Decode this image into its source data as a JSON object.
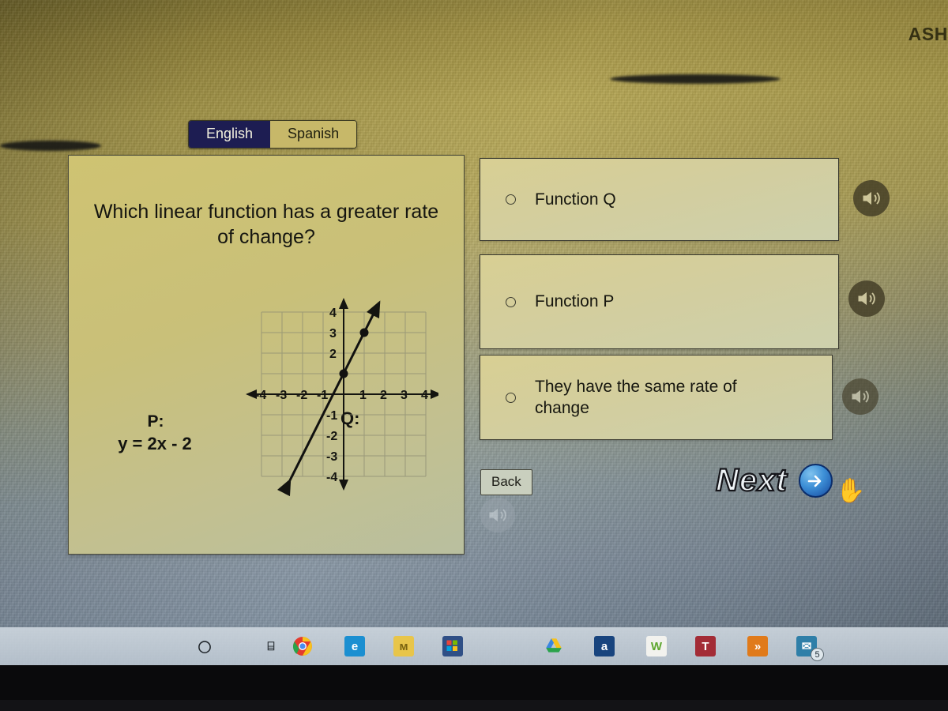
{
  "header": {
    "title": "ASH"
  },
  "language_tabs": [
    {
      "label": "English",
      "selected": true
    },
    {
      "label": "Spanish",
      "selected": false
    }
  ],
  "question": {
    "text": "Which linear function has a greater rate of change?",
    "function_p_label": "P:",
    "function_p_equation": "y = 2x - 2",
    "function_q_label": "Q:"
  },
  "chart_data": {
    "type": "line",
    "title": "Q:",
    "xlabel": "",
    "ylabel": "",
    "xlim": [
      -5,
      5
    ],
    "ylim": [
      -5,
      5
    ],
    "grid": true,
    "x_ticks": [
      -4,
      -3,
      -2,
      -1,
      1,
      2,
      3,
      4
    ],
    "y_ticks": [
      4,
      3,
      2,
      -1,
      -2,
      -3,
      -4
    ],
    "x_tick_labels": [
      "-4",
      "-3",
      "-2",
      "-1",
      "1",
      "2",
      "3",
      "4"
    ],
    "y_tick_labels": [
      "4",
      "3",
      "2",
      "-1",
      "-2",
      "-3",
      "-4"
    ],
    "series": [
      {
        "name": "Function Q",
        "slope": 2,
        "intercept": 1,
        "points": [
          [
            0,
            1
          ],
          [
            1,
            3
          ]
        ],
        "x": [
          -2.6,
          1.6
        ],
        "y": [
          -4.2,
          4.2
        ]
      }
    ]
  },
  "options": [
    {
      "label": "Function Q",
      "selected": false,
      "audio_icon": "speaker-icon"
    },
    {
      "label": "Function P",
      "selected": false,
      "audio_icon": "speaker-icon"
    },
    {
      "label": "They have the same rate of change",
      "selected": false,
      "audio_icon": "speaker-icon"
    }
  ],
  "nav": {
    "back_label": "Back",
    "next_label": "Next"
  },
  "taskbar": {
    "items": [
      {
        "name": "cortana-icon",
        "glyph": "◯",
        "color": "transparent",
        "text_color": "#20262b"
      },
      {
        "name": "task-view-icon",
        "glyph": "⌸",
        "color": "transparent",
        "text_color": "#20262b"
      },
      {
        "name": "chrome-icon",
        "glyph": "",
        "color": "#f4c20d",
        "text_color": "#ffffff"
      },
      {
        "name": "edge-icon",
        "glyph": "e",
        "color": "#1b8fd1",
        "text_color": "#ffffff"
      },
      {
        "name": "notes-app-icon",
        "glyph": "ᴍ",
        "color": "#e8c54a",
        "text_color": "#7b6410"
      },
      {
        "name": "microsoft-store-icon",
        "glyph": "⊞",
        "color": "#2f4f86",
        "text_color": "#ffffff"
      },
      {
        "name": "google-drive-icon",
        "glyph": "△",
        "color": "transparent",
        "text_color": "#2a9d5c"
      },
      {
        "name": "amazon-icon",
        "glyph": "a",
        "color": "#18447e",
        "text_color": "#ffffff"
      },
      {
        "name": "w-app-icon",
        "glyph": "W",
        "color": "#f2f2ee",
        "text_color": "#5ea72f"
      },
      {
        "name": "t-app-icon",
        "glyph": "T",
        "color": "#a32c36",
        "text_color": "#ffffff"
      },
      {
        "name": "fast-forward-icon",
        "glyph": "»",
        "color": "#e07a1a",
        "text_color": "#ffffff"
      },
      {
        "name": "mail-icon",
        "glyph": "✉",
        "color": "#2f7fa8",
        "text_color": "#ffffff",
        "badge": "5"
      }
    ]
  },
  "colors": {
    "tab_selected_bg": "#1d1d52",
    "panel_bg": "#cfc372",
    "next_arrow": "#14479e"
  }
}
